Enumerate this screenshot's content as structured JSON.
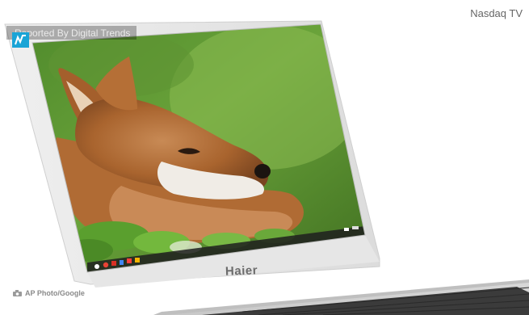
{
  "header": {
    "brand": "Nasdaq TV"
  },
  "badge": {
    "text": "Reported By Digital Trends",
    "logo_icon": "nasdaq-n-logo-icon",
    "logo_color": "#1aa4d6"
  },
  "credit": {
    "text": "AP Photo/Google",
    "icon": "camera-icon"
  },
  "laptop": {
    "brand_label": "Haier",
    "taskbar_icons": [
      "launcher-icon",
      "chrome-icon",
      "gmail-icon",
      "docs-icon",
      "youtube-icon",
      "files-icon"
    ],
    "status_area_icons": [
      "wifi-icon",
      "battery-icon"
    ],
    "wallpaper": "fox-wallpaper"
  }
}
